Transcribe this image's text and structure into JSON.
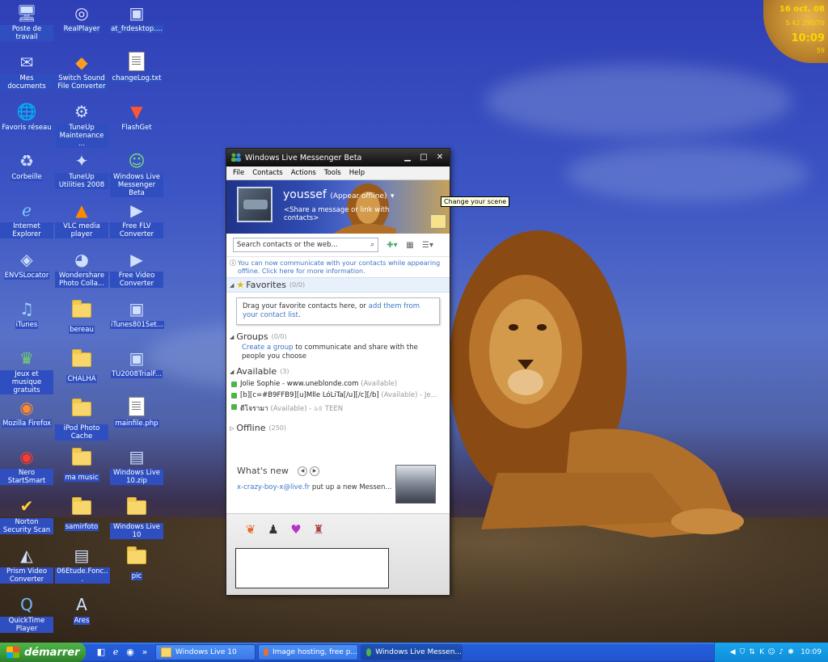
{
  "desktop_icons": [
    {
      "label": "Poste de travail",
      "icon": "computer-icon"
    },
    {
      "label": "RealPlayer",
      "icon": "realplayer-icon"
    },
    {
      "label": "at_frdesktop....",
      "icon": "setup-icon"
    },
    {
      "label": "Mes documents",
      "icon": "documents-folder-icon"
    },
    {
      "label": "Switch Sound File Converter",
      "icon": "switch-icon"
    },
    {
      "label": "changeLog.txt",
      "icon": "text-file-icon"
    },
    {
      "label": "Favoris réseau",
      "icon": "network-icon"
    },
    {
      "label": "TuneUp Maintenance ...",
      "icon": "tuneup-icon"
    },
    {
      "label": "FlashGet",
      "icon": "flashget-icon"
    },
    {
      "label": "Corbeille",
      "icon": "recycle-bin-icon"
    },
    {
      "label": "TuneUp Utilities 2008",
      "icon": "tuneup-utilities-icon"
    },
    {
      "label": "Windows Live Messenger Beta",
      "icon": "messenger-icon"
    },
    {
      "label": "Internet Explorer",
      "icon": "ie-icon"
    },
    {
      "label": "VLC media player",
      "icon": "vlc-icon"
    },
    {
      "label": "Free FLV Converter",
      "icon": "flv-icon"
    },
    {
      "label": "ENVSLocator",
      "icon": "locator-icon"
    },
    {
      "label": "Wondershare Photo Colla...",
      "icon": "wondershare-icon"
    },
    {
      "label": "Free Video Converter",
      "icon": "video-converter-icon"
    },
    {
      "label": "iTunes",
      "icon": "itunes-icon"
    },
    {
      "label": "bereau",
      "icon": "folder-icon"
    },
    {
      "label": "iTunes801Set...",
      "icon": "installer-icon"
    },
    {
      "label": "Jeux et musique gratuits",
      "icon": "games-icon"
    },
    {
      "label": "CHALHA",
      "icon": "folder-icon"
    },
    {
      "label": "TU2008TrialF...",
      "icon": "installer-icon"
    },
    {
      "label": "Mozilla Firefox",
      "icon": "firefox-icon"
    },
    {
      "label": "iPod Photo Cache",
      "icon": "folder-icon"
    },
    {
      "label": "mainfile.php",
      "icon": "php-file-icon"
    },
    {
      "label": "Nero StartSmart",
      "icon": "nero-icon"
    },
    {
      "label": "ma music",
      "icon": "folder-icon"
    },
    {
      "label": "Windows Live 10.zip",
      "icon": "zip-icon"
    },
    {
      "label": "Norton Security Scan",
      "icon": "norton-icon"
    },
    {
      "label": "samirfoto",
      "icon": "folder-icon"
    },
    {
      "label": "Windows Live 10",
      "icon": "folder-icon"
    },
    {
      "label": "Prism Video Converter",
      "icon": "prism-icon"
    },
    {
      "label": "06Etude.Fonc...",
      "icon": "pdf-icon"
    },
    {
      "label": "pic",
      "icon": "folder-icon"
    },
    {
      "label": "QuickTime Player",
      "icon": "quicktime-icon"
    },
    {
      "label": "Ares",
      "icon": "ares-icon"
    }
  ],
  "clock_widget": {
    "date": "16 oct. 08",
    "sub": "S 42 290/76",
    "time": "10:09",
    "seconds": "59"
  },
  "messenger": {
    "title": "Windows Live Messenger Beta",
    "window_buttons": {
      "minimize": "▁",
      "maximize": "□",
      "close": "✕"
    },
    "menu": [
      "File",
      "Contacts",
      "Actions",
      "Tools",
      "Help"
    ],
    "user": {
      "name": "youssef",
      "status": "(Appear offline)",
      "message": "<Share a message or link with contacts>"
    },
    "scene_tooltip": "Change your scene",
    "search_placeholder": "Search contacts or the web...",
    "notice": "You can now communicate with your contacts while appearing offline. Click here for more information.",
    "favorites": {
      "label": "Favorites",
      "count": "(0/0)",
      "text_before": "Drag your favorite contacts here, or ",
      "link": "add them from your contact list",
      "text_after": "."
    },
    "groups": {
      "label": "Groups",
      "count": "(0/0)",
      "link": "Create a group",
      "text": " to communicate and share with the people you choose"
    },
    "available": {
      "label": "Available",
      "count": "(3)",
      "contacts": [
        {
          "name": "Jolie Sophie - www.uneblonde.com",
          "status": "(Available)"
        },
        {
          "name": "[b][c=#B9FFB9][u]Mlle LóLiTa[/u][/c][/b]",
          "status": "(Available) - Je..."
        },
        {
          "name": "ดีโจรามา",
          "status": "(Available) - ৯৪ TEEN"
        }
      ]
    },
    "offline": {
      "label": "Offline",
      "count": "(250)"
    },
    "whats_new": {
      "title": "What's new",
      "link": "x-crazy-boy-x@live.fr",
      "text": " put up a new Messen..."
    }
  },
  "taskbar": {
    "start_label": "démarrer",
    "buttons": [
      {
        "label": "Windows Live 10"
      },
      {
        "label": "Image hosting, free p..."
      },
      {
        "label": "Windows Live Messen..."
      }
    ],
    "clock": "10:09"
  }
}
